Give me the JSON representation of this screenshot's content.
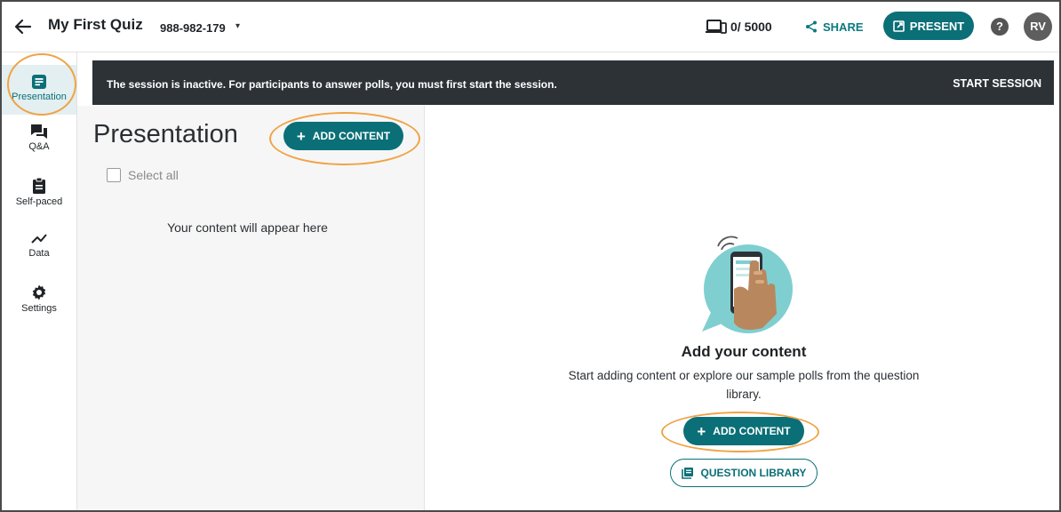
{
  "header": {
    "title": "My First Quiz",
    "session_code": "988-982-179",
    "participant_count": "0/ 5000",
    "share_label": "SHARE",
    "present_label": "PRESENT",
    "help_glyph": "?",
    "avatar_initials": "RV"
  },
  "sidebar": {
    "items": [
      {
        "label": "Presentation",
        "icon": "presentation-icon",
        "active": true
      },
      {
        "label": "Q&A",
        "icon": "chat-icon"
      },
      {
        "label": "Self-paced",
        "icon": "clipboard-icon"
      },
      {
        "label": "Data",
        "icon": "chart-line-icon"
      },
      {
        "label": "Settings",
        "icon": "gear-icon"
      }
    ]
  },
  "banner": {
    "message": "The session is inactive. For participants to answer polls, you must first start the session.",
    "action_label": "START SESSION"
  },
  "left_panel": {
    "title": "Presentation",
    "add_content_label": "ADD CONTENT",
    "select_all_label": "Select all",
    "empty_message": "Your content will appear here"
  },
  "main": {
    "heading": "Add your content",
    "description": "Start adding content or explore our sample polls from the question library.",
    "add_content_label": "ADD CONTENT",
    "question_library_label": "QUESTION LIBRARY"
  },
  "colors": {
    "accent": "#0b6f77",
    "banner_bg": "#2d3237",
    "highlight": "#f0a346",
    "active_bg": "#e3eff0"
  }
}
